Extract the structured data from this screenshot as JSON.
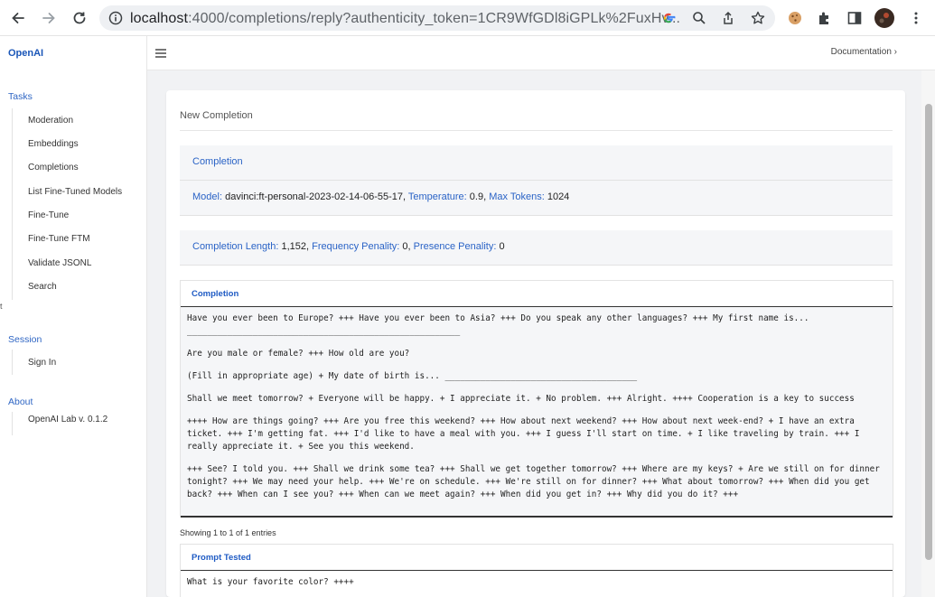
{
  "browser": {
    "url_host": "localhost",
    "url_rest": ":4000/completions/reply?authenticity_token=1CR9WfGDl8iGPLk%2FuxHv..."
  },
  "sidebar": {
    "brand": "OpenAI",
    "sections": [
      {
        "title": "Tasks",
        "items": [
          "Moderation",
          "Embeddings",
          "Completions",
          "List Fine-Tuned Models",
          "Fine-Tune",
          "Fine-Tune FTM",
          "Validate JSONL",
          "Search"
        ]
      },
      {
        "title": "Session",
        "items": [
          "Sign In"
        ]
      },
      {
        "title": "About",
        "items": [
          "OpenAI Lab v. 0.1.2"
        ]
      }
    ],
    "edge_char": "t"
  },
  "header": {
    "documentation": "Documentation ›"
  },
  "card": {
    "title": "New Completion",
    "completion_heading": "Completion",
    "model_label": "Model:",
    "model_value": "davinci:ft-personal-2023-02-14-06-55-17,",
    "temperature_label": "Temperature:",
    "temperature_value": "0.9,",
    "max_tokens_label": "Max Tokens:",
    "max_tokens_value": "1024",
    "completion_length_label": "Completion Length:",
    "completion_length_value": "1,152,",
    "frequency_label": "Frequency Penality:",
    "frequency_value": "0,",
    "presence_label": "Presence Penality:",
    "presence_value": "0"
  },
  "completion_table": {
    "header": "Completion",
    "paragraphs": [
      "Have you ever been to Europe? +++ Have you ever been to Asia? +++ Do you speak any other languages? +++ My first name is... ______________________________________________________",
      "Are you male or female? +++ How old are you?",
      "(Fill in appropriate age) + My date of birth is... ______________________________________",
      "Shall we meet tomorrow? + Everyone will be happy. + I appreciate it. + No problem. +++ Alright. ++++ Cooperation is a key to success",
      "++++ How are things going? +++ Are you free this weekend? +++ How about next weekend? +++ How about next week-end? + I have an extra ticket. +++ I'm getting fat. +++ I'd like to have a meal with you. +++ I guess I'll start on time. + I like traveling by train. +++ I really appreciate it. + See you this weekend.",
      "+++ See? I told you. +++ Shall we drink some tea? +++ Shall we get together tomorrow? +++ Where are my keys? + Are we still on for dinner tonight? +++ We may need your help. +++ We're on schedule. +++ We're still on for dinner? +++ What about tomorrow? +++ When did you get back? +++ When can I see you? +++ When can we meet again? +++ When did you get in? +++ Why did you do it? +++"
    ],
    "showing": "Showing 1 to 1 of 1 entries"
  },
  "prompt_table": {
    "header": "Prompt Tested",
    "text": "What is your favorite color? ++++"
  }
}
